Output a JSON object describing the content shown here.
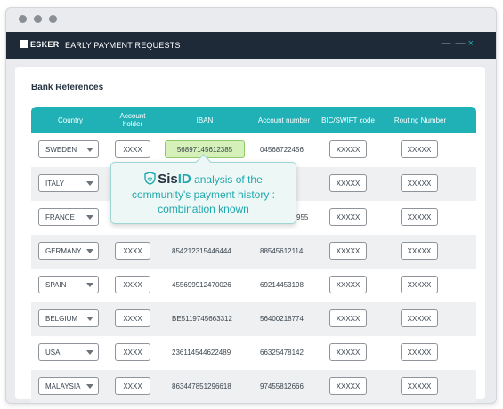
{
  "app": {
    "logo": "ESKER",
    "title": "EARLY PAYMENT REQUESTS",
    "window_controls": "— —",
    "close_glyph": "×"
  },
  "section": {
    "title": "Bank References"
  },
  "table": {
    "headers": [
      "Country",
      "Account holder",
      "IBAN",
      "Account number",
      "BIC/SWIFT code",
      "Routing Number"
    ],
    "rows": [
      {
        "country": "SWEDEN",
        "holder": "XXXX",
        "iban": "56897145612385",
        "account": "04568722456",
        "bic": "XXXXX",
        "routing": "XXXXX"
      },
      {
        "country": "ITALY",
        "holder": "",
        "iban": "",
        "account": "",
        "bic": "XXXXX",
        "routing": "XXXXX"
      },
      {
        "country": "FRANCE",
        "holder": "",
        "iban": "",
        "account": "955",
        "bic": "XXXXX",
        "routing": "XXXXX"
      },
      {
        "country": "GERMANY",
        "holder": "XXXX",
        "iban": "854212315446444",
        "account": "88545612114",
        "bic": "XXXXX",
        "routing": "XXXXX"
      },
      {
        "country": "SPAIN",
        "holder": "XXXX",
        "iban": "455699912470026",
        "account": "69214453198",
        "bic": "XXXXX",
        "routing": "XXXXX"
      },
      {
        "country": "BELGIUM",
        "holder": "XXXX",
        "iban": "BE5119745663312",
        "account": "56400218774",
        "bic": "XXXXX",
        "routing": "XXXXX"
      },
      {
        "country": "USA",
        "holder": "XXXX",
        "iban": "236114544622489",
        "account": "66325478142",
        "bic": "XXXXX",
        "routing": "XXXXX"
      },
      {
        "country": "MALAYSIA",
        "holder": "XXXX",
        "iban": "863447851296618",
        "account": "97455812666",
        "bic": "XXXXX",
        "routing": "XXXXX"
      }
    ]
  },
  "tooltip": {
    "brand_s": "Sis",
    "brand_id": "ID",
    "line1": "analysis of the",
    "line2": "community's payment history :",
    "line3": "combination known"
  },
  "colors": {
    "accent": "#1fb1b6",
    "header_bar": "#1e2a38",
    "iban_highlight": "#d5f0b8"
  }
}
